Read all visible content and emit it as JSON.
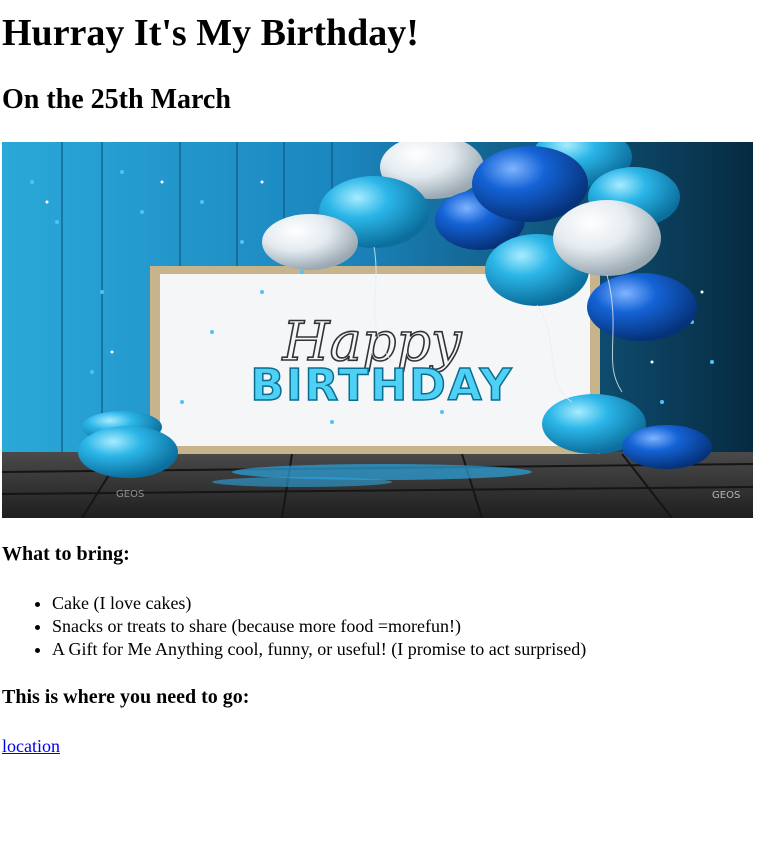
{
  "heading": "Hurray It's My Birthday!",
  "subheading": "On the 25th March",
  "banner": {
    "script_text": "Happy",
    "block_text": "BIRTHDAY",
    "colors": {
      "wall": "#1e8fc4",
      "wall_dark": "#0a3d5c",
      "floor": "#3a3a3a",
      "frame": "#c8b48a",
      "board": "#f4f6f8",
      "balloon_cyan": "#2bb6e8",
      "balloon_blue": "#1463d6",
      "balloon_white": "#e8eef2",
      "text_cyan": "#4fd0f5"
    }
  },
  "bring_title": "What to bring:",
  "bring_items": [
    "Cake (I love cakes)",
    "Snacks or treats to share (because more food =morefun!)",
    "A Gift for Me Anything cool, funny, or useful! (I promise to act surprised)"
  ],
  "go_title": "This is where you need to go:",
  "location_link": "location"
}
